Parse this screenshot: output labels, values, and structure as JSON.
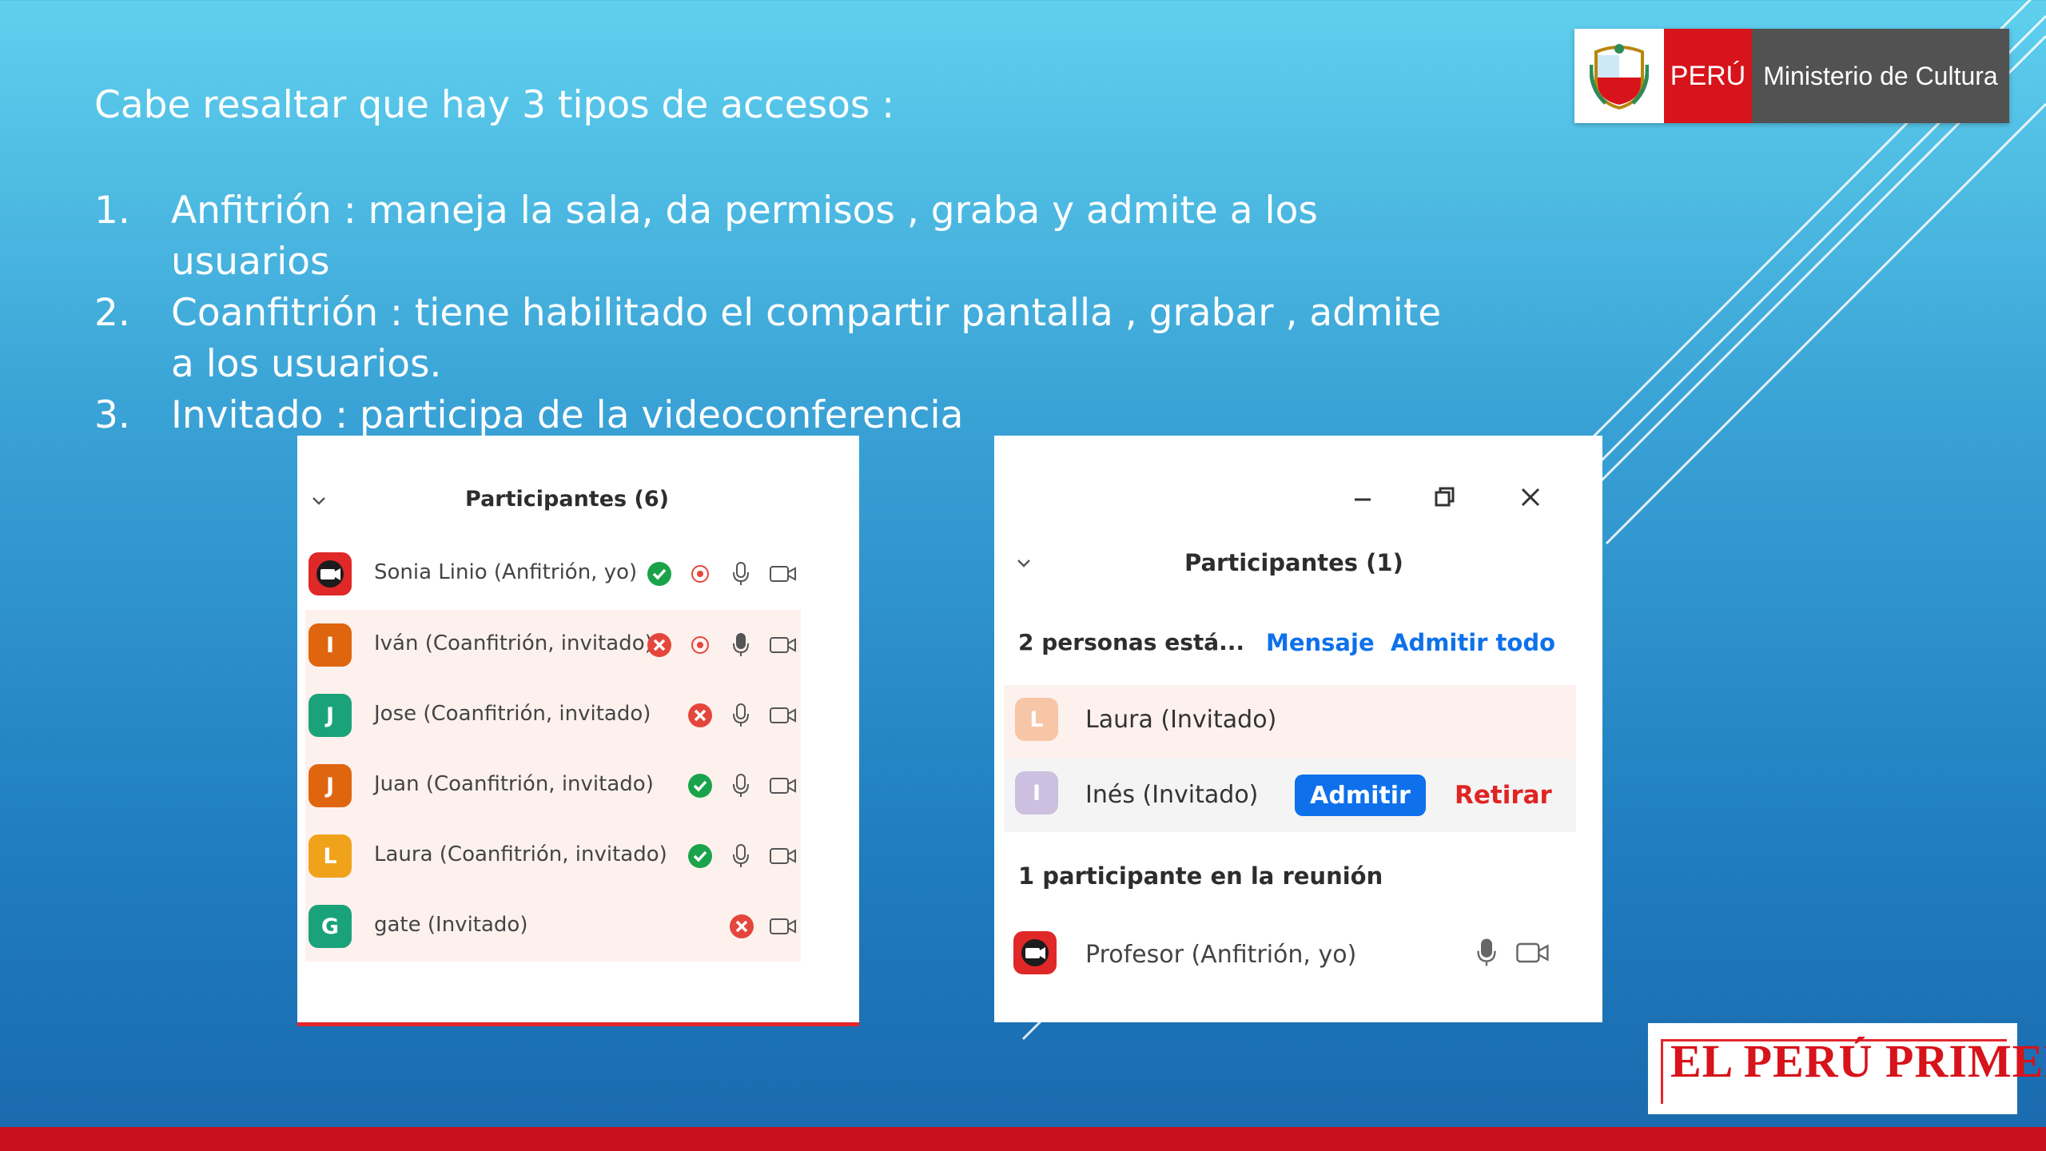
{
  "slide": {
    "intro": "Cabe resaltar que hay 3 tipos de accesos :",
    "items": [
      {
        "num": "1.",
        "text": "Anfitrión : maneja la sala, da permisos , graba y admite a los usuarios"
      },
      {
        "num": "2.",
        "text": "Coanfitrión : tiene habilitado el compartir pantalla , grabar , admite a los usuarios."
      },
      {
        "num": "3.",
        "text": "Invitado : participa de la videoconferencia"
      }
    ]
  },
  "logo": {
    "country": "PERÚ",
    "ministry": "Ministerio de Cultura"
  },
  "panel1": {
    "title": "Participantes (6)",
    "participants": [
      {
        "name": "Sonia Linio (Anfitrión, yo)",
        "avatar": "",
        "avatar_color": "#e02828",
        "status": "allowed"
      },
      {
        "name": "Iván (Coanfitrión, invitado)",
        "avatar": "I",
        "avatar_color": "#e0650f",
        "status": "denied"
      },
      {
        "name": "Jose (Coanfitrión, invitado)",
        "avatar": "J",
        "avatar_color": "#1aa37a",
        "status": "denied"
      },
      {
        "name": "Juan (Coanfitrión, invitado)",
        "avatar": "J",
        "avatar_color": "#e0650f",
        "status": "allowed"
      },
      {
        "name": "Laura (Coanfitrión, invitado)",
        "avatar": "L",
        "avatar_color": "#f0a21a",
        "status": "allowed"
      },
      {
        "name": "gate (Invitado)",
        "avatar": "G",
        "avatar_color": "#1aa37a",
        "status": "denied"
      }
    ]
  },
  "panel2": {
    "title": "Participantes (1)",
    "waiting_text": "2 personas está...",
    "message_link": "Mensaje",
    "admit_all_link": "Admitir todo",
    "waiting": [
      {
        "name": "Laura (Invitado)",
        "avatar": "L",
        "avatar_color": "#f7c6a6"
      },
      {
        "name": "Inés (Invitado)",
        "avatar": "I",
        "avatar_color": "#cdbfe0"
      }
    ],
    "admit_label": "Admitir",
    "remove_label": "Retirar",
    "in_meeting_text": "1 participante en la reunión",
    "host": {
      "name": "Profesor (Anfitrión, yo)"
    }
  },
  "brand": {
    "text": "EL PERÚ PRIMERO"
  },
  "colors": {
    "allowed": "#1aa34a",
    "denied": "#e5463c",
    "zoom_blue": "#0e71eb",
    "retirar_red": "#e02323",
    "brand_red": "#d7131b"
  }
}
